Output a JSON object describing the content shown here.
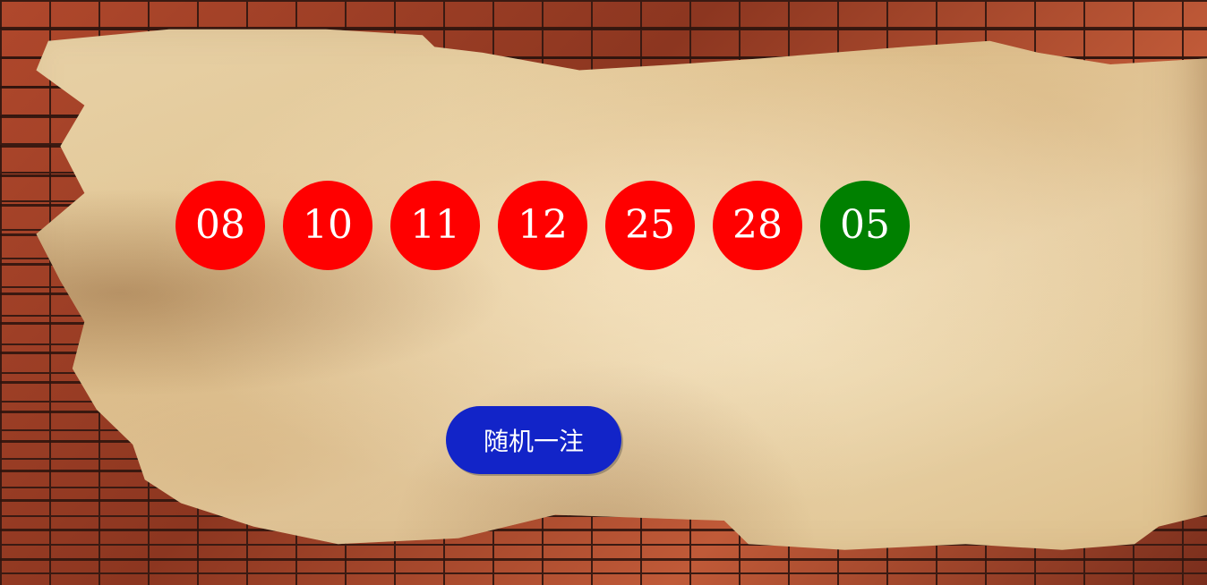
{
  "balls": {
    "red": [
      "08",
      "10",
      "11",
      "12",
      "25",
      "28"
    ],
    "blue": [
      "05"
    ]
  },
  "colors": {
    "red_ball": "#ff0000",
    "blue_ball": "#008000",
    "button": "#1224c8"
  },
  "actions": {
    "random_pick_label": "随机一注"
  }
}
